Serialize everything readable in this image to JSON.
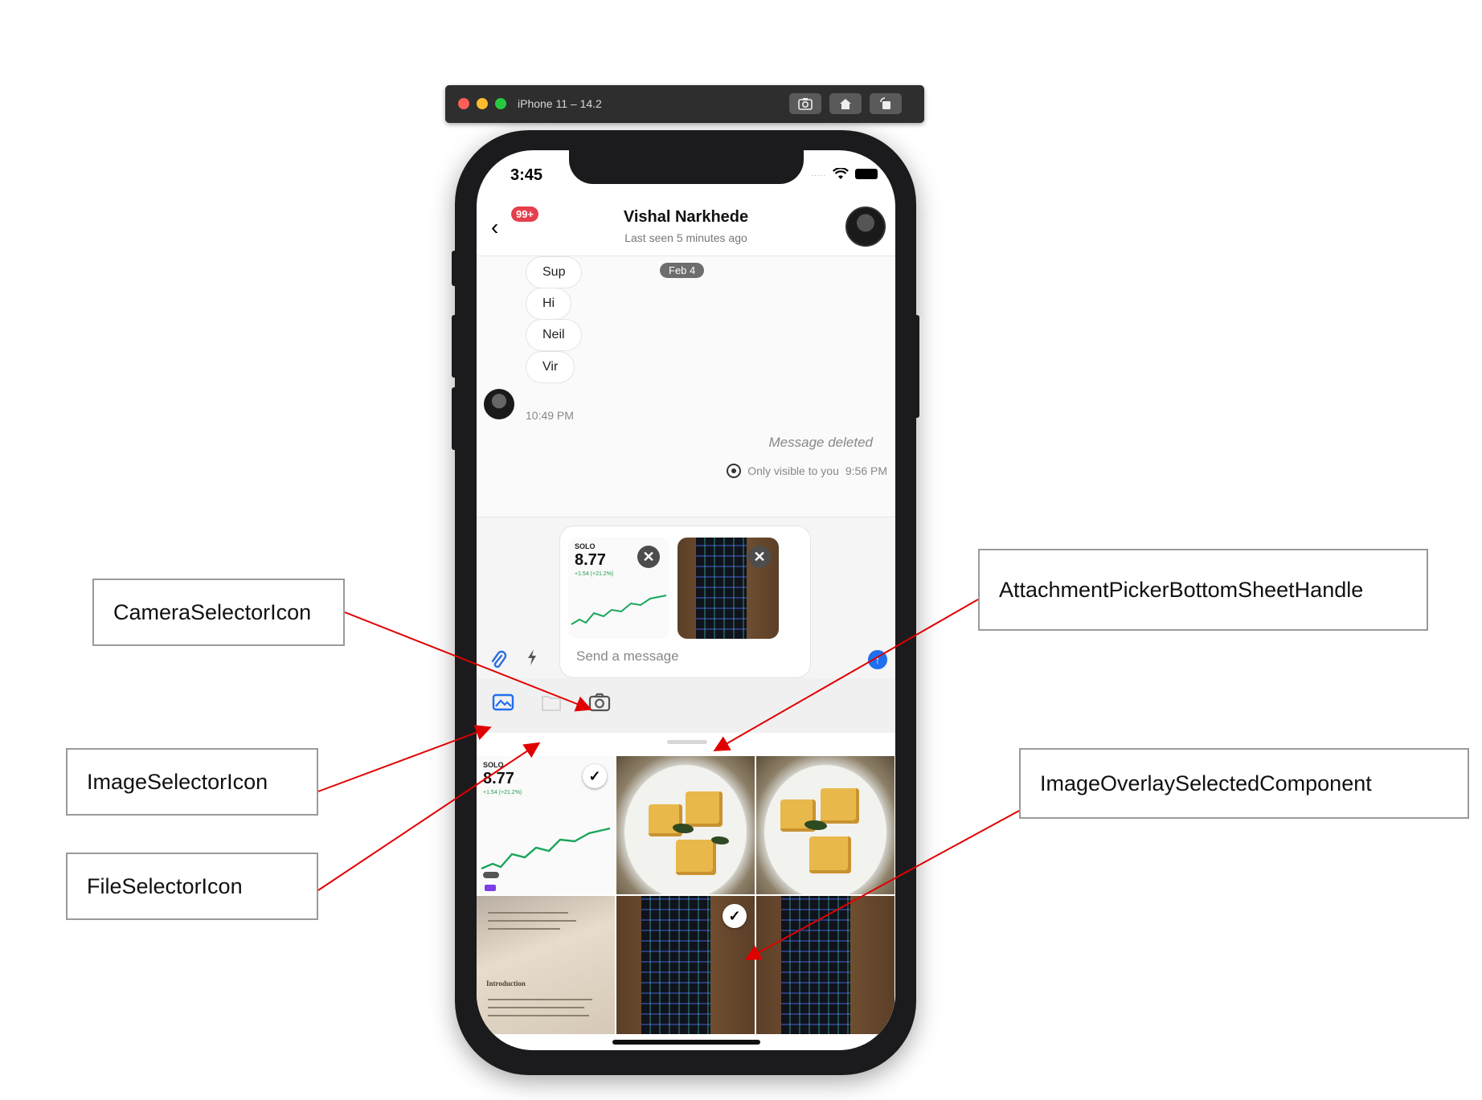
{
  "simulator": {
    "title": "iPhone 11 – 14.2",
    "buttons": [
      "screenshot-icon",
      "home-icon",
      "rotate-icon"
    ],
    "traffic_colors": [
      "#ff5f57",
      "#febc2e",
      "#28c840"
    ]
  },
  "status_bar": {
    "time": "3:45",
    "signal": "....."
  },
  "header": {
    "unread_badge": "99+",
    "name": "Vishal Narkhede",
    "subtitle": "Last seen 5 minutes ago"
  },
  "messages": {
    "date_chip": "Feb 4",
    "bubbles": [
      "Sup",
      "Hi",
      "Neil",
      "Vir"
    ],
    "time": "10:49 PM",
    "deleted_text": "Message deleted",
    "visibility_note": "Only visible to you",
    "deleted_time": "9:56 PM"
  },
  "composer": {
    "placeholder": "Send a message",
    "stock_card": {
      "symbol": "SOLO",
      "price": "8.77",
      "change": "+1.54 (+21.2%)"
    },
    "remove_symbol": "✕"
  },
  "picker": {
    "tabs": [
      "image-selector-icon",
      "file-selector-icon",
      "camera-selector-icon"
    ],
    "grid_stock": {
      "symbol": "SOLO",
      "price": "8.77",
      "change": "+1.54 (+21.2%)"
    },
    "selected_mark": "✓",
    "paper_heading": "Introduction"
  },
  "annotations": {
    "camera": "CameraSelectorIcon",
    "image": "ImageSelectorIcon",
    "file": "FileSelectorIcon",
    "handle": "AttachmentPickerBottomSheetHandle",
    "overlay": "ImageOverlaySelectedComponent"
  },
  "colors": {
    "accent": "#1f6fef",
    "badge": "#e53f4d",
    "annotation_line": "#e00000"
  }
}
